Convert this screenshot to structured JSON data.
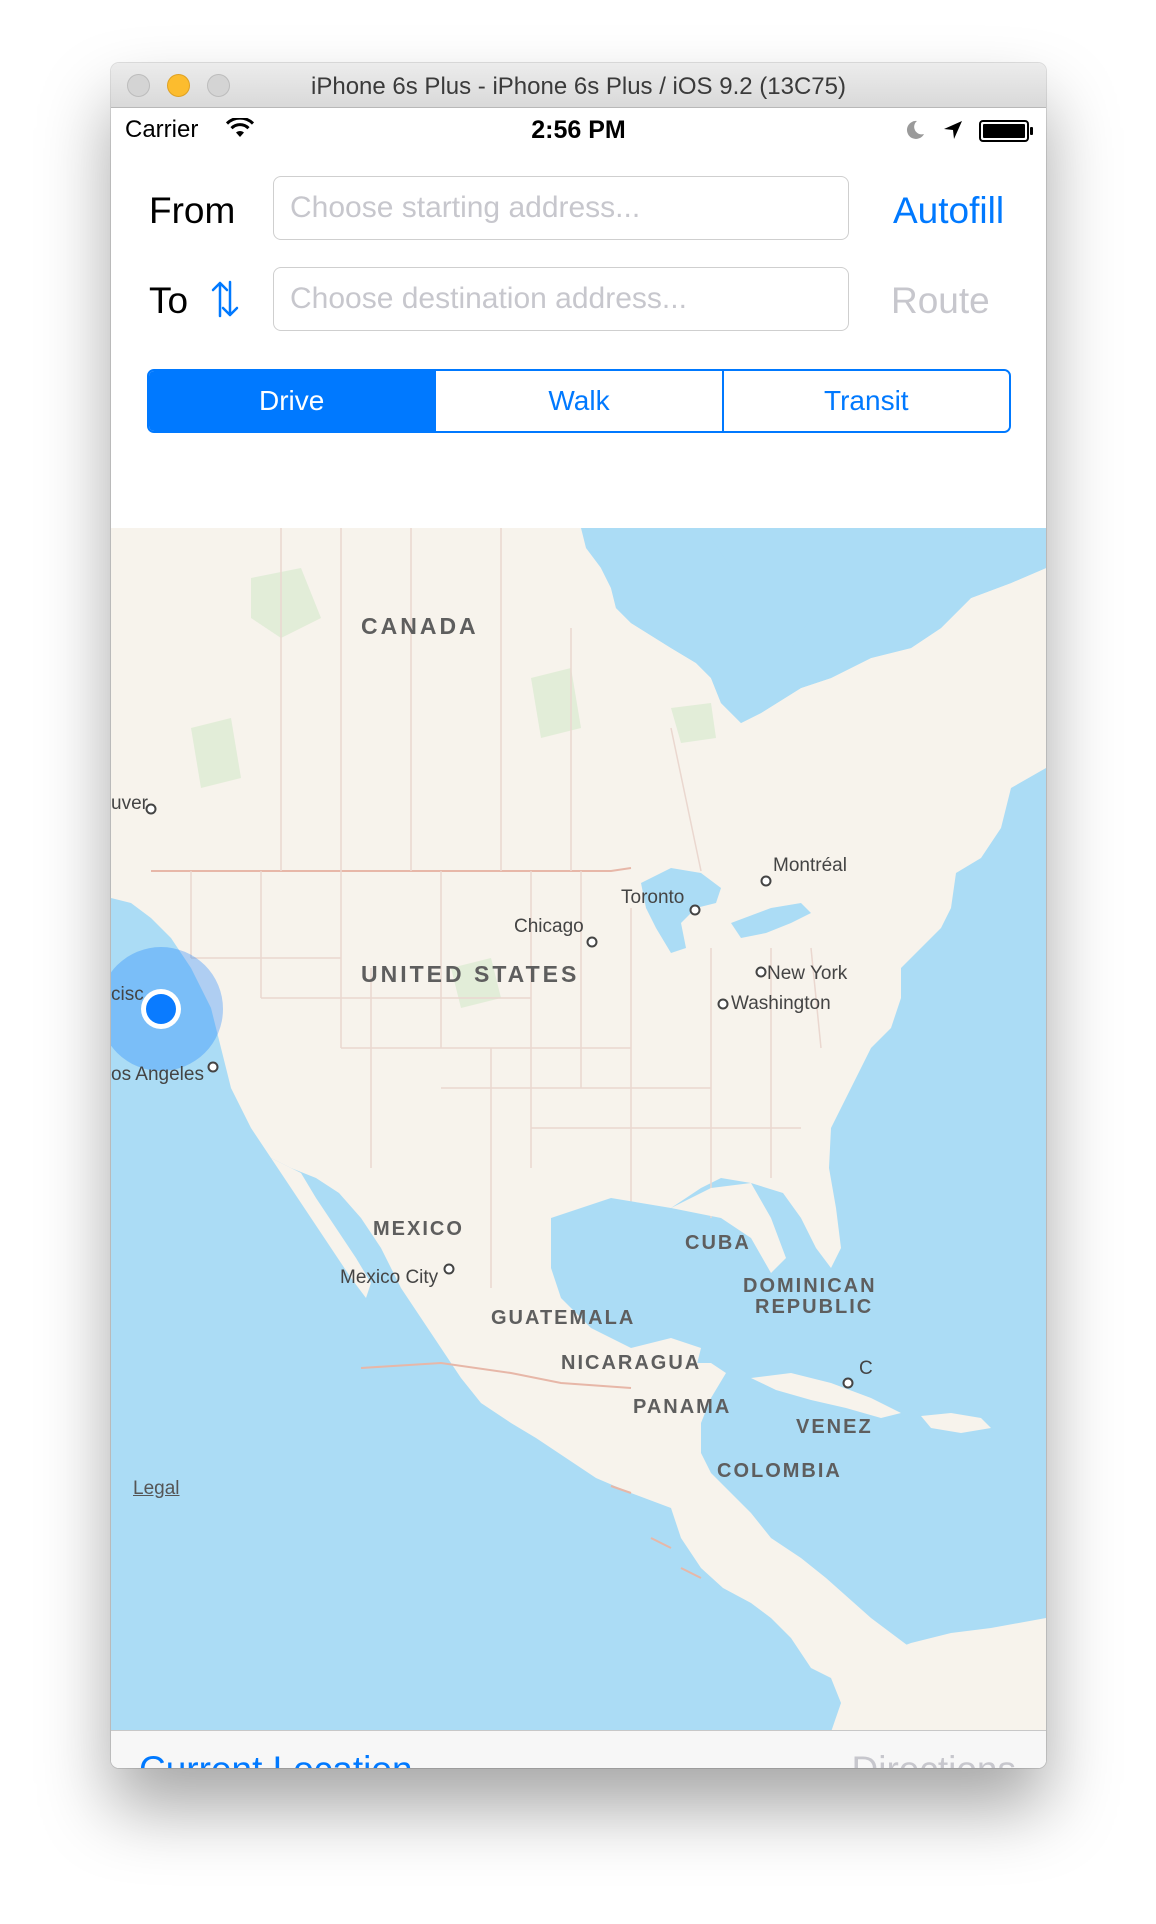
{
  "window": {
    "title": "iPhone 6s Plus - iPhone 6s Plus / iOS 9.2 (13C75)"
  },
  "status_bar": {
    "carrier": "Carrier",
    "time": "2:56 PM"
  },
  "form": {
    "from_label": "From",
    "from_placeholder": "Choose starting address...",
    "from_value": "",
    "autofill_label": "Autofill",
    "to_label": "To",
    "to_placeholder": "Choose destination address...",
    "to_value": "",
    "route_label": "Route"
  },
  "transport_modes": {
    "options": [
      "Drive",
      "Walk",
      "Transit"
    ],
    "selected": "Drive"
  },
  "map": {
    "labels": {
      "canada": "CANADA",
      "united_states": "UNITED STATES",
      "mexico": "MEXICO",
      "cuba": "CUBA",
      "dominican_republic_1": "DOMINICAN",
      "dominican_republic_2": "REPUBLIC",
      "guatemala": "GUATEMALA",
      "nicaragua": "NICARAGUA",
      "panama": "PANAMA",
      "venezuela": "VENEZ",
      "colombia": "COLOMBIA"
    },
    "cities": {
      "vancouver": "uver",
      "montreal": "Montréal",
      "toronto": "Toronto",
      "chicago": "Chicago",
      "new_york": "New York",
      "washington": "Washington",
      "san_francisco": "cisc",
      "los_angeles": "os Angeles",
      "mexico_city": "Mexico City",
      "caracas": "C"
    },
    "legal": "Legal"
  },
  "toolbar": {
    "current_location": "Current Location",
    "directions": "Directions"
  },
  "colors": {
    "accent": "#0079ff",
    "disabled": "#c7c7cd",
    "water": "#abdcf5",
    "land": "#f7f3ec",
    "user_location": "#0a7bff"
  }
}
